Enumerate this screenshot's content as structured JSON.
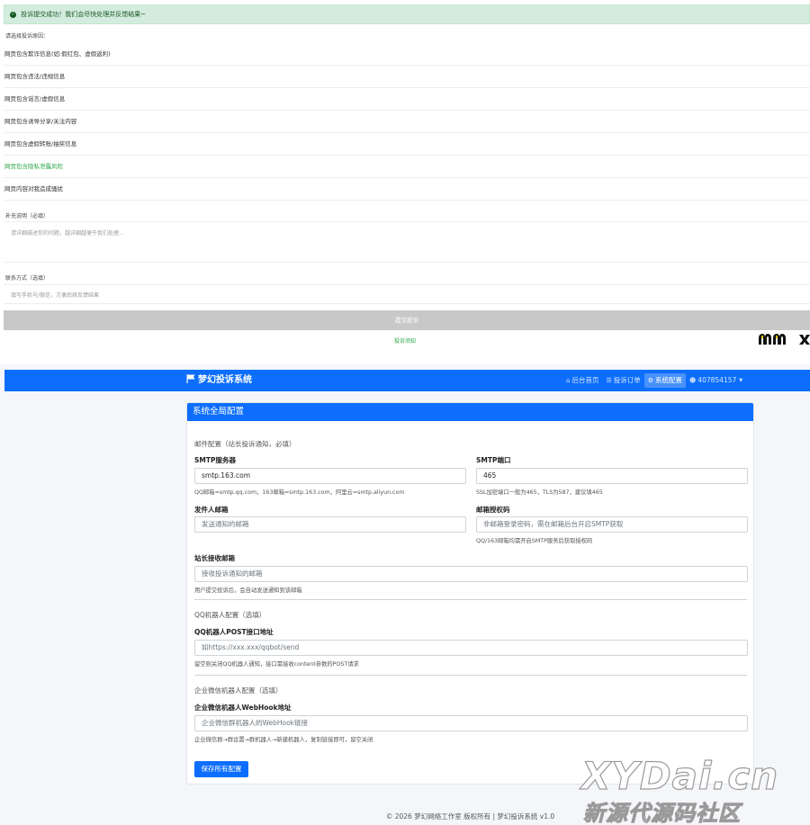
{
  "complaint_form": {
    "success_alert": "投诉提交成功！我们会尽快处理并反馈结果~",
    "reason_label": "请选择投诉原因：",
    "reasons": [
      "网页包含欺诈信息(如:假红包、虚假返利)",
      "网页包含违法/违规信息",
      "网页包含谣言/虚假信息",
      "网页包含诱导分享/关注内容",
      "网页包含虚假转账/抽奖信息",
      "网页包含隐私泄露风险",
      "网页内容对我造成骚扰"
    ],
    "selected_reason_index": 5,
    "supplement_label": "补充说明（必填）",
    "supplement_placeholder": "请详细描述你的问题，越详细越便于我们处理...",
    "contact_label": "联系方式（选填）",
    "contact_placeholder": "填写手机号/微信，方便后续反馈结果",
    "submit_label": "提交投诉",
    "notice_link": "投诉须知"
  },
  "admin": {
    "brand": "梦幻投诉系统",
    "nav": [
      {
        "icon": "home-icon",
        "glyph": "⌂",
        "label": "后台首页"
      },
      {
        "icon": "list-icon",
        "glyph": "☰",
        "label": "投诉订单"
      },
      {
        "icon": "gear-icon",
        "glyph": "⚙",
        "label": "系统配置"
      },
      {
        "icon": "user-icon",
        "glyph": "☻",
        "label": "407854157"
      }
    ],
    "card_title": "系统全局配置",
    "mail_section": "邮件配置（站长投诉通知，必填）",
    "smtp_server": {
      "label": "SMTP服务器",
      "value": "smtp.163.com",
      "hint": "QQ邮箱=smtp.qq.com，163邮箱=smtp.163.com，阿里云=smtp.aliyun.com"
    },
    "smtp_port": {
      "label": "SMTP端口",
      "value": "465",
      "hint": "SSL加密端口一般为465，TLS为587，建议填465"
    },
    "sender_email": {
      "label": "发件人邮箱",
      "placeholder": "发送通知的邮箱"
    },
    "auth_code": {
      "label": "邮箱授权码",
      "placeholder": "非邮箱登录密码，需在邮箱后台开启SMTP获取",
      "hint": "QQ/163邮箱均需开启SMTP服务后获取授权码"
    },
    "admin_email": {
      "label": "站长接收邮箱",
      "placeholder": "接收投诉通知的邮箱",
      "hint": "用户提交投诉后，会自动发送通知到该邮箱"
    },
    "qq_section": "QQ机器人配置（选填）",
    "qq_post": {
      "label": "QQ机器人POST接口地址",
      "placeholder": "如https://xxx.xxx/qqbot/send",
      "hint": "留空则关闭QQ机器人通知，接口需接收content参数的POST请求"
    },
    "wecom_section": "企业微信机器人配置（选填）",
    "wecom_webhook": {
      "label": "企业微信机器人WebHook地址",
      "placeholder": "企业微信群机器人的WebHook链接",
      "hint": "企业微信群→群设置→群机器人→新建机器人，复制链接即可，留空关闭"
    },
    "save_label": "保存所有配置",
    "footer": "© 2026 梦幻网络工作室 版权所有 | 梦幻投诉系统 v1.0"
  },
  "watermark": {
    "line1": "XYDai.cn",
    "line2": "新源代源码社区"
  },
  "colors": {
    "primary": "#0d6efd",
    "success": "#28a745",
    "alert_bg": "#d4ecdd"
  }
}
